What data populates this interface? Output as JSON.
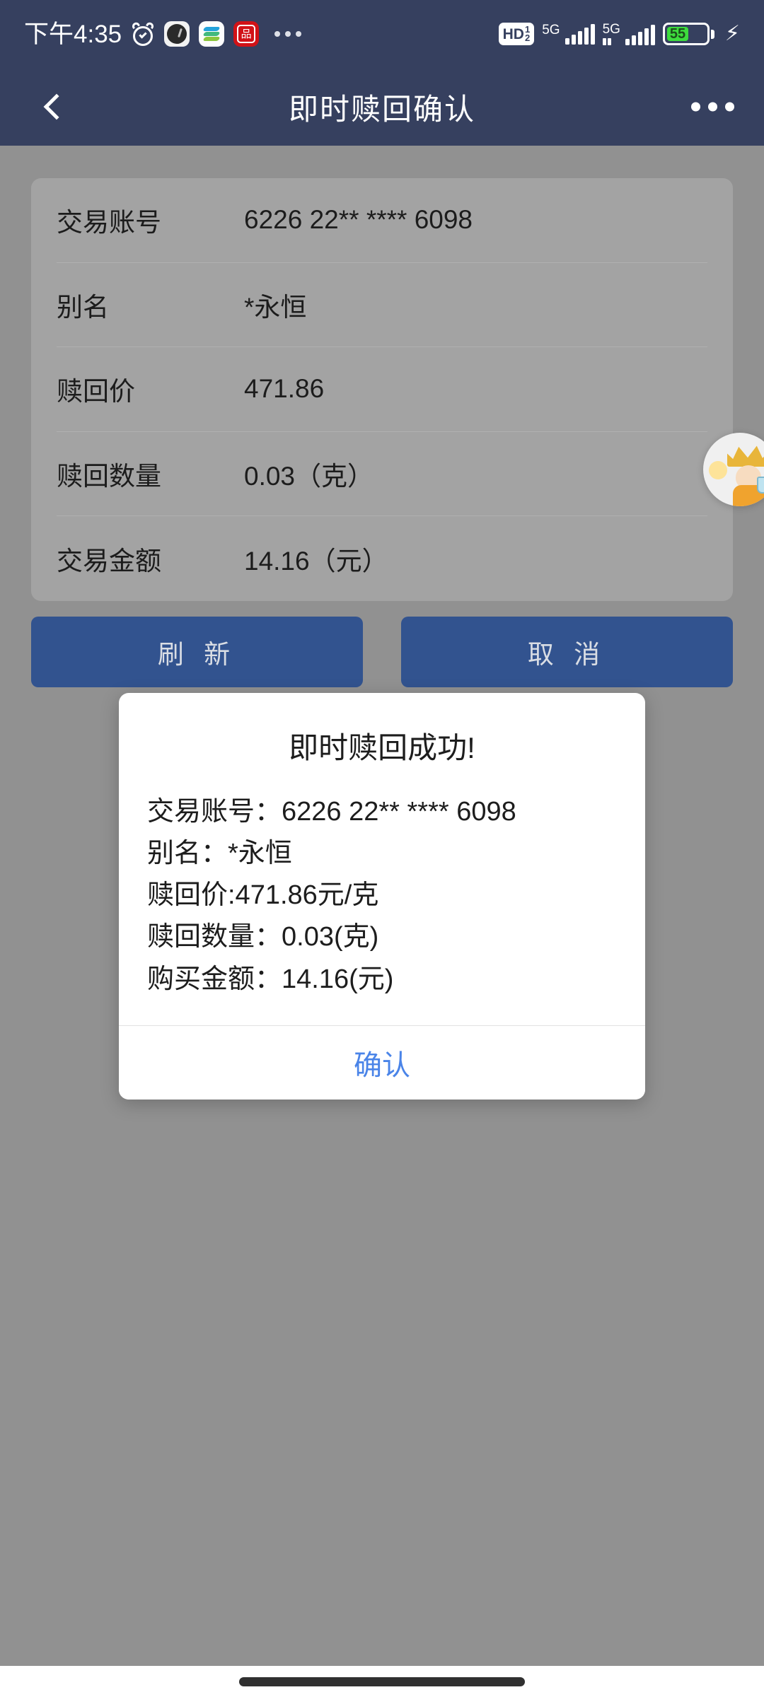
{
  "status_bar": {
    "time": "下午4:35",
    "alarm_icon": "alarm-clock-icon",
    "app_icons": [
      "dark-watch-app-icon",
      "china-mobile-app-icon",
      "bank-app-icon"
    ],
    "bank_icon_glyph": "品",
    "overflow": "...",
    "hd_label": "HD",
    "hd_numerator": "1",
    "hd_denominator": "2",
    "sim1_network": "5G",
    "sim2_network": "5G",
    "battery_level": "55",
    "charging_glyph": "⚡"
  },
  "header": {
    "back_icon": "back-chevron-icon",
    "title": "即时赎回确认",
    "more_icon": "more-options-icon"
  },
  "card": {
    "rows": [
      {
        "label": "交易账号",
        "value": "6226 22** **** 6098"
      },
      {
        "label": "别名",
        "value": "*永恒"
      },
      {
        "label": "赎回价",
        "value": "471.86"
      },
      {
        "label": "赎回数量",
        "value": "0.03（克）"
      },
      {
        "label": "交易金额",
        "value": "14.16（元）"
      }
    ]
  },
  "actions": {
    "refresh_label": "刷 新",
    "cancel_label": "取 消",
    "button_color": "#32538f"
  },
  "float_widget": {
    "name": "crown-mascot-floating-icon"
  },
  "dialog": {
    "title": "即时赎回成功!",
    "lines": [
      "交易账号：6226 22** **** 6098",
      "别名：*永恒",
      "赎回价:471.86元/克",
      "赎回数量：0.03(克)",
      "购买金额：14.16(元)"
    ],
    "confirm_label": "确认",
    "confirm_color": "#4a84e8"
  },
  "nav_bar": {
    "gesture_pill": "home-gesture-indicator"
  },
  "theme": {
    "header_bg": "#36405f",
    "page_bg": "#919191",
    "card_bg": "#a3a3a3",
    "dialog_bg": "#ffffff"
  }
}
